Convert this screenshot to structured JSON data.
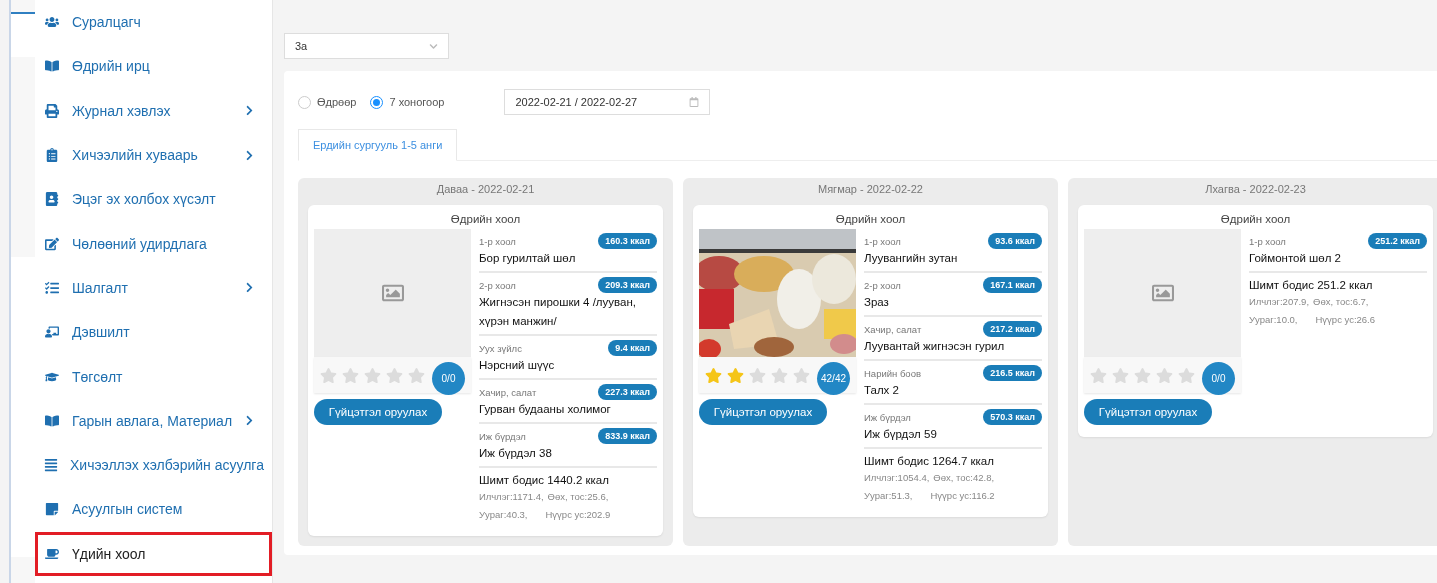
{
  "sidebar": {
    "items": [
      {
        "label": "Суралцагч",
        "has_submenu": false,
        "selected": false
      },
      {
        "label": "Өдрийн ирц",
        "has_submenu": false,
        "selected": false
      },
      {
        "label": "Журнал хэвлэх",
        "has_submenu": true,
        "selected": false
      },
      {
        "label": "Хичээлийн хуваарь",
        "has_submenu": true,
        "selected": false
      },
      {
        "label": "Эцэг эх холбох хүсэлт",
        "has_submenu": false,
        "selected": false
      },
      {
        "label": "Чөлөөний удирдлага",
        "has_submenu": false,
        "selected": false
      },
      {
        "label": "Шалгалт",
        "has_submenu": true,
        "selected": false
      },
      {
        "label": "Дэвшилт",
        "has_submenu": false,
        "selected": false
      },
      {
        "label": "Төгсөлт",
        "has_submenu": false,
        "selected": false
      },
      {
        "label": "Гарын авлага, Материал",
        "has_submenu": true,
        "selected": false
      },
      {
        "label": "Хичээллэх хэлбэрийн асуулга",
        "has_submenu": false,
        "selected": false
      },
      {
        "label": "Асуулгын систем",
        "has_submenu": false,
        "selected": false
      },
      {
        "label": "Үдийн хоол",
        "has_submenu": false,
        "selected": true
      }
    ]
  },
  "class_select": {
    "value": "3а"
  },
  "period": {
    "options": [
      {
        "label": "Өдрөөр",
        "selected": false
      },
      {
        "label": "7 хоногоор",
        "selected": true
      }
    ],
    "date_range": "2022-02-21 / 2022-02-27"
  },
  "tabs": [
    {
      "label": "Ердийн сургууль 1-5 анги",
      "selected": true
    }
  ],
  "days": [
    {
      "title": "Даваа - 2022-02-21",
      "meal": {
        "title": "Өдрийн хоол",
        "image": {
          "kind": "placeholder"
        },
        "stars": 0,
        "rating": "0/0",
        "button": "Гүйцэтгэл оруулах",
        "dishes": [
          {
            "category": "1-р хоол",
            "kcal": "160.3 ккал",
            "name": "Бор гурилтай шөл"
          },
          {
            "category": "2-р хоол",
            "kcal": "209.3 ккал",
            "name": "Жигнэсэн пирошки 4 /лууван, хүрэн манжин/"
          },
          {
            "category": "Уух зүйлс",
            "kcal": "9.4 ккал",
            "name": "Нэрсний шүүс"
          },
          {
            "category": "Хачир, салат",
            "kcal": "227.3 ккал",
            "name": "Гурван будааны холимог"
          },
          {
            "category": "Иж бүрдэл",
            "kcal": "833.9 ккал",
            "name": "Иж бүрдэл 38"
          }
        ],
        "nutrition": {
          "total": "Шимт бодис 1440.2 ккал",
          "values": [
            "Илчлэг:1171.4,",
            "Өөх, тос:25.6,",
            "Уураг:40.3,",
            "Нүүрс ус:202.9"
          ]
        }
      }
    },
    {
      "title": "Мягмар - 2022-02-22",
      "meal": {
        "title": "Өдрийн хоол",
        "stars": 2,
        "rating": "42/42",
        "button": "Гүйцэтгэл оруулах",
        "dishes": [
          {
            "category": "1-р хоол",
            "kcal": "93.6 ккал",
            "name": "Луувангийн зутан"
          },
          {
            "category": "2-р хоол",
            "kcal": "167.1 ккал",
            "name": "Зраз"
          },
          {
            "category": "Хачир, салат",
            "kcal": "217.2 ккал",
            "name": "Луувантай жигнэсэн гурил"
          },
          {
            "category": "Нарийн боов",
            "kcal": "216.5 ккал",
            "name": "Талх 2"
          },
          {
            "category": "Иж бүрдэл",
            "kcal": "570.3 ккал",
            "name": "Иж бүрдэл 59"
          }
        ],
        "nutrition": {
          "total": "Шимт бодис 1264.7 ккал",
          "values": [
            "Илчлэг:1054.4,",
            "Өөх, тос:42.8,",
            "Уураг:51.3,",
            "Нүүрс ус:116.2"
          ]
        }
      }
    },
    {
      "title": "Лхагва - 2022-02-23",
      "meal": {
        "title": "Өдрийн хоол",
        "image": {
          "kind": "placeholder"
        },
        "stars": 0,
        "rating": "0/0",
        "button": "Гүйцэтгэл оруулах",
        "dishes": [
          {
            "category": "1-р хоол",
            "kcal": "251.2 ккал",
            "name": "Гоймонтой шөл 2"
          }
        ],
        "nutrition": {
          "total": "Шимт бодис 251.2 ккал",
          "values": [
            "Илчлэг:207.9,",
            "Өөх, тос:6.7,",
            "Уураг:10.0,",
            "Нүүрс ус:26.6"
          ]
        }
      }
    }
  ]
}
